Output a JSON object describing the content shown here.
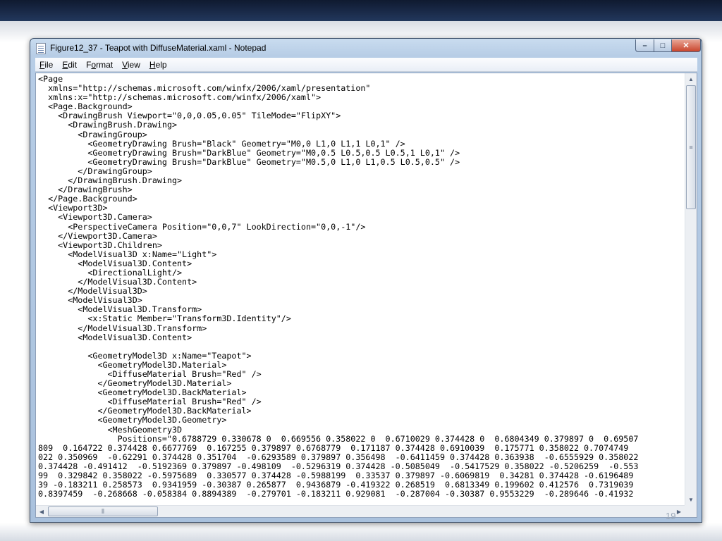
{
  "window": {
    "title": "Figure12_37 - Teapot with DiffuseMaterial.xaml - Notepad",
    "controls": {
      "minimize": "–",
      "maximize": "□",
      "close": "✕"
    }
  },
  "menu": [
    {
      "access": "F",
      "rest": "ile"
    },
    {
      "access": "E",
      "rest": "dit"
    },
    {
      "access": "o",
      "prefix": "F",
      "rest": "rmat"
    },
    {
      "access": "V",
      "rest": "iew"
    },
    {
      "access": "H",
      "rest": "elp"
    }
  ],
  "editor": {
    "lines": [
      "<Page",
      "  xmlns=\"http://schemas.microsoft.com/winfx/2006/xaml/presentation\"",
      "  xmlns:x=\"http://schemas.microsoft.com/winfx/2006/xaml\">",
      "  <Page.Background>",
      "    <DrawingBrush Viewport=\"0,0,0.05,0.05\" TileMode=\"FlipXY\">",
      "      <DrawingBrush.Drawing>",
      "        <DrawingGroup>",
      "          <GeometryDrawing Brush=\"Black\" Geometry=\"M0,0 L1,0 L1,1 L0,1\" />",
      "          <GeometryDrawing Brush=\"DarkBlue\" Geometry=\"M0,0.5 L0.5,0.5 L0.5,1 L0,1\" />",
      "          <GeometryDrawing Brush=\"DarkBlue\" Geometry=\"M0.5,0 L1,0 L1,0.5 L0.5,0.5\" />",
      "        </DrawingGroup>",
      "      </DrawingBrush.Drawing>",
      "    </DrawingBrush>",
      "  </Page.Background>",
      "  <Viewport3D>",
      "    <Viewport3D.Camera>",
      "      <PerspectiveCamera Position=\"0,0,7\" LookDirection=\"0,0,-1\"/>",
      "    </Viewport3D.Camera>",
      "    <Viewport3D.Children>",
      "      <ModelVisual3D x:Name=\"Light\">",
      "        <ModelVisual3D.Content>",
      "          <DirectionalLight/>",
      "        </ModelVisual3D.Content>",
      "      </ModelVisual3D>",
      "      <ModelVisual3D>",
      "        <ModelVisual3D.Transform>",
      "          <x:Static Member=\"Transform3D.Identity\"/>",
      "        </ModelVisual3D.Transform>",
      "        <ModelVisual3D.Content>",
      "",
      "          <GeometryModel3D x:Name=\"Teapot\">",
      "            <GeometryModel3D.Material>",
      "              <DiffuseMaterial Brush=\"Red\" />",
      "            </GeometryModel3D.Material>",
      "            <GeometryModel3D.BackMaterial>",
      "              <DiffuseMaterial Brush=\"Red\" />",
      "            </GeometryModel3D.BackMaterial>",
      "            <GeometryModel3D.Geometry>",
      "              <MeshGeometry3D",
      "                Positions=\"0.6788729 0.330678 0  0.669556 0.358022 0  0.6710029 0.374428 0  0.6804349 0.379897 0  0.69507",
      "809  0.164722 0.374428 0.6677769  0.167255 0.379897 0.6768779  0.171187 0.374428 0.6910039  0.175771 0.358022 0.7074749",
      "022 0.350969  -0.62291 0.374428 0.351704  -0.6293589 0.379897 0.356498  -0.6411459 0.374428 0.363938  -0.6555929 0.358022",
      "0.374428 -0.491412  -0.5192369 0.379897 -0.498109  -0.5296319 0.374428 -0.5085049  -0.5417529 0.358022 -0.5206259  -0.553",
      "99  0.329842 0.358022 -0.5975689  0.330577 0.374428 -0.5988199  0.33537 0.379897 -0.6069819  0.34281 0.374428 -0.6196489",
      "39 -0.183211 0.258573  0.9341959 -0.30387 0.265877  0.9436879 -0.419322 0.268519  0.6813349 0.199602 0.412576  0.7319039",
      "0.8397459  -0.268668 -0.058384 0.8894389  -0.279701 -0.183211 0.929081  -0.287004 -0.30387 0.9553229  -0.289646 -0.41932"
    ]
  },
  "slide": {
    "page_number": "19"
  }
}
